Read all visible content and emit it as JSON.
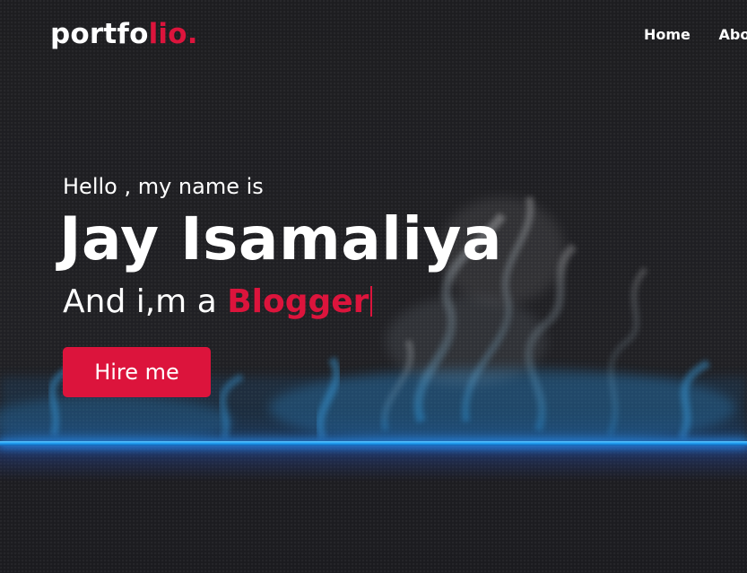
{
  "navbar": {
    "logo_main": "portfo",
    "logo_accent": "lio.",
    "links": [
      "Home",
      "About"
    ]
  },
  "hero": {
    "greeting": "Hello , my name is",
    "name": "Jay Isamaliya",
    "role_prefix": "And i,m a ",
    "role_word": "Blogger",
    "cta_label": "Hire me"
  },
  "colors": {
    "accent": "#dc143c",
    "background": "#1c1c1e",
    "glow": "#1e9bf0"
  }
}
